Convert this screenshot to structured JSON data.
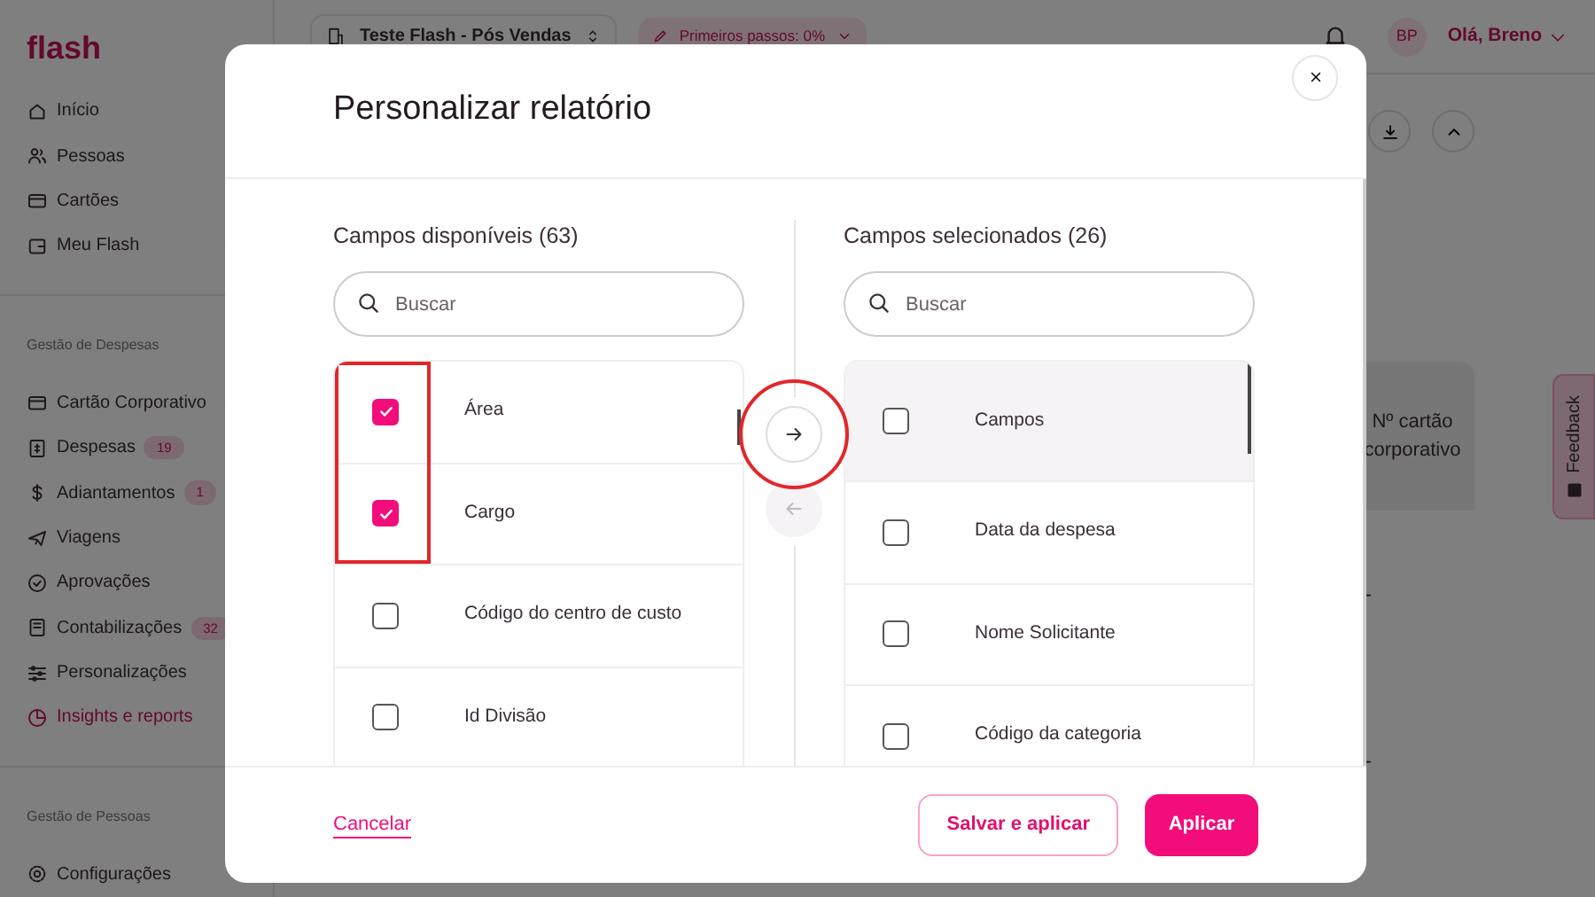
{
  "sidebar": {
    "logo": "flash",
    "groups": [
      {
        "items": [
          {
            "label": "Início",
            "selected": false,
            "expandable": false
          },
          {
            "label": "Pessoas",
            "selected": false,
            "expandable": false
          },
          {
            "label": "Cartões",
            "selected": false,
            "expandable": false
          },
          {
            "label": "Meu Flash",
            "selected": false,
            "expandable": true
          }
        ]
      },
      {
        "heading": "Gestão de Despesas",
        "items": [
          {
            "label": "Cartão Corporativo",
            "selected": false,
            "expandable": true
          },
          {
            "label": "Despesas",
            "badge": "19",
            "selected": false,
            "expandable": false
          },
          {
            "label": "Adiantamentos",
            "badge": "1",
            "selected": false,
            "expandable": false
          },
          {
            "label": "Viagens",
            "selected": false,
            "expandable": false
          },
          {
            "label": "Aprovações",
            "selected": false,
            "expandable": false
          },
          {
            "label": "Contabilizações",
            "badge": "32",
            "selected": false,
            "expandable": false
          },
          {
            "label": "Personalizações",
            "selected": false,
            "expandable": false
          },
          {
            "label": "Insights e reports",
            "selected": true,
            "expandable": false
          }
        ]
      },
      {
        "heading": "Gestão de Pessoas",
        "items": [
          {
            "label": "Configurações",
            "selected": false,
            "expandable": false
          }
        ]
      }
    ]
  },
  "topbar": {
    "company": "Teste Flash - Pós Vendas",
    "progress_chip": "Primeiros passos: 0%",
    "user": {
      "initials": "BP",
      "greeting": "Olá, Breno"
    }
  },
  "background_table": {
    "header": "Nº cartão corporativo",
    "cells": [
      "-",
      "-"
    ]
  },
  "feedback_tab": "Feedback",
  "modal": {
    "title": "Personalizar relatório",
    "available": {
      "title": "Campos disponíveis (63)",
      "search_placeholder": "Buscar",
      "fields": [
        {
          "label": "Área",
          "checked": true
        },
        {
          "label": "Cargo",
          "checked": true
        },
        {
          "label": "Código do centro de custo",
          "checked": false
        },
        {
          "label": "Id Divisão",
          "checked": false
        }
      ]
    },
    "move_right": {
      "disabled": false
    },
    "move_left": {
      "disabled": true
    },
    "selected_fields": {
      "title": "Campos selecionados (26)",
      "search_placeholder": "Buscar",
      "fields": [
        {
          "label": "Campos",
          "checked": false,
          "highlighted": true
        },
        {
          "label": "Data da despesa",
          "checked": false,
          "highlighted": false
        },
        {
          "label": "Nome Solicitante",
          "checked": false,
          "highlighted": false
        },
        {
          "label": "Código da categoria",
          "checked": false,
          "highlighted": false
        }
      ]
    },
    "footer": {
      "cancel": "Cancelar",
      "save": "Salvar e aplicar",
      "apply": "Aplicar"
    }
  },
  "annotation_rectangle": {
    "color": "#e3262a"
  },
  "annotation_circle": {
    "color": "#e3262a"
  }
}
